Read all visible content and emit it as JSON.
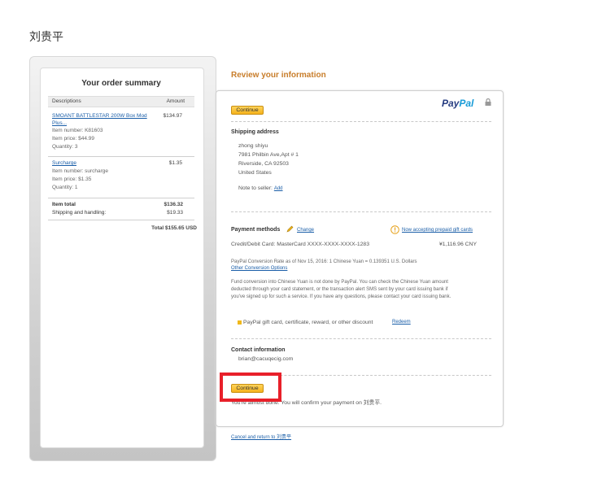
{
  "merchant": {
    "name": "刘贵平"
  },
  "summary": {
    "title": "Your order summary",
    "col_desc": "Descriptions",
    "col_amount": "Amount",
    "items": [
      {
        "name_line1": "SMOANT BATTLESTAR 200W Box Mod",
        "name_line2": "Plus...",
        "item_number": "Item number: K81603",
        "item_price": "Item price: $44.99",
        "quantity": "Quantity: 3",
        "amount": "$134.97"
      },
      {
        "name_line1": "Surcharge",
        "item_number": "Item number: surcharge",
        "item_price": "Item price: $1.35",
        "quantity": "Quantity: 1",
        "amount": "$1.35"
      }
    ],
    "item_total_label": "Item total",
    "item_total": "$136.32",
    "shipping_label": "Shipping and handling:",
    "shipping": "$19.33",
    "total": "Total $155.65 USD"
  },
  "review": {
    "title": "Review your information",
    "continue_label": "Continue",
    "paypal_pay": "Pay",
    "paypal_pal": "Pal",
    "shipping_title": "Shipping address",
    "address": [
      "zhong shiyu",
      "7981 Philbin Ave,Apt # 1",
      "Riverside, CA 92503",
      "United States"
    ],
    "note_label": "Note to seller:",
    "note_add": "Add",
    "payment_title": "Payment methods",
    "change_label": "Change",
    "prepaid_label": "Now accepting prepaid gift cards",
    "card_line": "Credit/Debit Card: MasterCard XXXX-XXXX-XXXX-1283",
    "card_amount": "¥1,116.96 CNY",
    "conversion_rate": "PayPal Conversion Rate as of Nov 15, 2016: 1 Chinese Yuan = 0.139351 U.S. Dollars",
    "other_options": "Other Conversion Options",
    "fund_notice_1": "Fund conversion into Chinese Yuan is not done by PayPal. You can check the Chinese Yuan amount",
    "fund_notice_2": "deducted through your card statement, or the transaction alert SMS sent by your card issuing bank if",
    "fund_notice_3": "you've signed up for such a service. If you have any questions, please contact your card issuing bank.",
    "gift_text": "PayPal gift card, certificate, reward, or other discount",
    "redeem": "Redeem",
    "contact_title": "Contact information",
    "contact_email": "brian@cacuqecig.com",
    "almost_done": "You're almost done. You will confirm your payment on 刘贵平.",
    "cancel_link": "Cancel and return to 刘贵平"
  },
  "colors": {
    "accent_orange": "#c87d2a",
    "button_yellow": "#f5b21c",
    "link_blue": "#1a5ea8",
    "highlight_red": "#e8202a"
  }
}
